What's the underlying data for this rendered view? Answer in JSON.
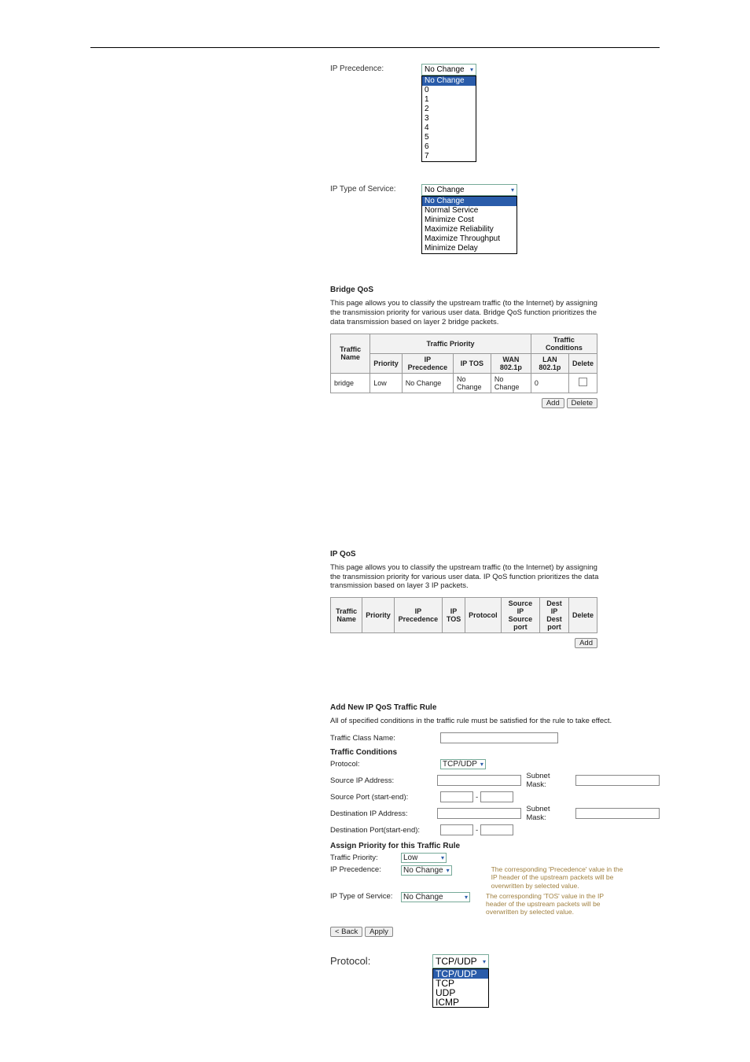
{
  "fig1": {
    "label": "IP Precedence:",
    "selected": "No Change",
    "options": [
      "No Change",
      "0",
      "1",
      "2",
      "3",
      "4",
      "5",
      "6",
      "7"
    ]
  },
  "fig2": {
    "label": "IP Type of Service:",
    "selected": "No Change",
    "options": [
      "No Change",
      "Normal Service",
      "Minimize Cost",
      "Maximize Reliability",
      "Maximize Throughput",
      "Minimize Delay"
    ]
  },
  "bridge": {
    "title": "Bridge QoS",
    "desc": "This page allows you to classify the upstream traffic (to the Internet) by assigning the transmission priority for various user data. Bridge QoS function prioritizes the data transmission based on layer 2 bridge packets.",
    "group1": "Traffic Priority",
    "group2": "Traffic Conditions",
    "headers": [
      "Traffic Name",
      "Priority",
      "IP Precedence",
      "IP TOS",
      "WAN 802.1p",
      "LAN 802.1p",
      "Delete"
    ],
    "row": {
      "name": "bridge",
      "priority": "Low",
      "prec": "No Change",
      "tos": "No Change",
      "wan": "No Change",
      "lan": "0"
    },
    "btn_add": "Add",
    "btn_delete": "Delete"
  },
  "ipqos": {
    "title": "IP QoS",
    "desc": "This page allows you to classify the upstream traffic (to the Internet) by assigning the transmission priority for various user data. IP QoS function prioritizes the data transmission based on layer 3 IP packets.",
    "headers": [
      "Traffic Name",
      "Priority",
      "IP Precedence",
      "IP TOS",
      "Protocol",
      "Source IP Source port",
      "Dest IP Dest port",
      "Delete"
    ],
    "btn_add": "Add"
  },
  "addrule": {
    "title": "Add New IP QoS Traffic Rule",
    "desc": "All of specified conditions in the traffic rule must be satisfied for the rule to take effect.",
    "traffic_class_label": "Traffic Class Name:",
    "cond_heading": "Traffic Conditions",
    "protocol_label": "Protocol:",
    "protocol_value": "TCP/UDP",
    "src_ip_label": "Source IP Address:",
    "subnet_label": "Subnet Mask:",
    "src_port_label": "Source Port (start-end):",
    "dash": "-",
    "dst_ip_label": "Destination IP Address:",
    "dst_port_label": "Destination Port(start-end):",
    "assign_heading": "Assign Priority for this Traffic Rule",
    "tp_label": "Traffic Priority:",
    "tp_value": "Low",
    "prec_label": "IP Precedence:",
    "prec_value": "No Change",
    "prec_hint": "The corresponding 'Precedence' value in the IP header of the upstream packets will be overwritten by selected value.",
    "tos_label": "IP Type of Service:",
    "tos_value": "No Change",
    "tos_hint": "The corresponding 'TOS' value in the IP header of the upstream packets will be overwritten by selected value.",
    "btn_back": "< Back",
    "btn_apply": "Apply"
  },
  "fig3": {
    "label": "Protocol:",
    "selected": "TCP/UDP",
    "options": [
      "TCP/UDP",
      "TCP",
      "UDP",
      "ICMP"
    ]
  }
}
